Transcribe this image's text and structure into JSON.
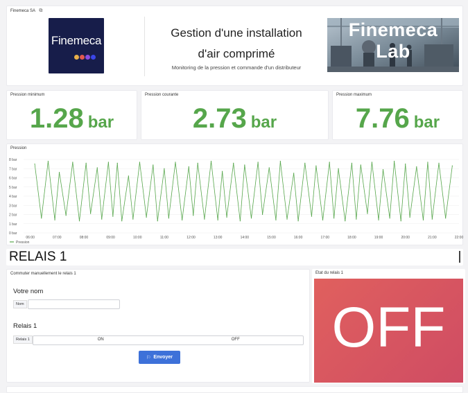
{
  "header_panel": {
    "title": "Finemeca SA",
    "link_icon": "external-link-icon",
    "logo": {
      "text": "Finemeca",
      "dot_colors": [
        "#e8b04a",
        "#e2594f",
        "#8a4ee0",
        "#3b46e8"
      ],
      "bg": "#171d4a"
    },
    "main_title_line1": "Gestion d'une installation",
    "main_title_line2": "d'air comprimé",
    "subtitle": "Monitoring de la pression et commande d'un distributeur",
    "photo_text_line1": "Finemeca",
    "photo_text_line2": "Lab"
  },
  "stats": [
    {
      "title": "Pression minimum",
      "value": "1.28",
      "unit": "bar"
    },
    {
      "title": "Pression courante",
      "value": "2.73",
      "unit": "bar"
    },
    {
      "title": "Pression maximum",
      "value": "7.76",
      "unit": "bar"
    }
  ],
  "colors": {
    "accent_green": "#56a64b",
    "button_blue": "#3d71d9",
    "off_red": "#d6545f"
  },
  "pressure_panel": {
    "title": "Pression",
    "legend": "Pression",
    "y_ticks": [
      "8 bar",
      "7 bar",
      "6 bar",
      "5 bar",
      "4 bar",
      "3 bar",
      "2 bar",
      "1 bar",
      "0 bar"
    ],
    "x_ticks": [
      "06:00",
      "07:00",
      "08:00",
      "09:00",
      "10:00",
      "11:00",
      "12:00",
      "13:00",
      "14:00",
      "15:00",
      "16:00",
      "17:00",
      "18:00",
      "19:00",
      "20:00",
      "21:00",
      "22:00"
    ]
  },
  "chart_data": {
    "type": "line",
    "series": [
      {
        "name": "Pression",
        "x": [
          "06:10",
          "06:25",
          "06:40",
          "06:55",
          "07:05",
          "07:20",
          "07:35",
          "07:50",
          "08:05",
          "08:15",
          "08:30",
          "08:40",
          "08:55",
          "09:05",
          "09:15",
          "09:25",
          "09:40",
          "09:50",
          "10:05",
          "10:20",
          "10:35",
          "10:45",
          "11:00",
          "11:10",
          "11:25",
          "11:40",
          "11:55",
          "12:05",
          "12:15",
          "12:30",
          "12:45",
          "13:00",
          "13:10",
          "13:20",
          "13:35",
          "13:50",
          "14:00",
          "14:15",
          "14:30",
          "14:40",
          "14:55",
          "15:10",
          "15:20",
          "15:35",
          "15:50",
          "16:00",
          "16:15",
          "16:30",
          "16:40",
          "16:55",
          "17:10",
          "17:20",
          "17:30",
          "17:45",
          "18:00",
          "18:10",
          "18:20",
          "18:35",
          "18:45",
          "19:00",
          "19:10",
          "19:25",
          "19:35",
          "19:50",
          "20:00",
          "20:10",
          "20:25",
          "20:40",
          "20:50",
          "21:00",
          "21:15",
          "21:30",
          "21:45"
        ],
        "values": [
          7.5,
          1.6,
          7.8,
          1.4,
          6.6,
          1.9,
          7.7,
          1.3,
          7.6,
          2.1,
          7.1,
          1.5,
          7.7,
          1.8,
          7.6,
          1.3,
          6.2,
          1.5,
          7.7,
          1.7,
          7.4,
          1.3,
          7.0,
          1.6,
          7.7,
          1.4,
          7.2,
          1.9,
          7.6,
          1.5,
          7.8,
          1.4,
          6.7,
          1.7,
          7.6,
          1.3,
          7.4,
          1.6,
          7.7,
          2.0,
          7.1,
          1.4,
          7.8,
          1.5,
          6.5,
          1.3,
          7.6,
          1.8,
          7.3,
          1.4,
          7.7,
          1.6,
          7.0,
          1.3,
          7.6,
          1.5,
          7.4,
          2.1,
          7.7,
          1.4,
          6.9,
          1.6,
          7.8,
          1.3,
          7.5,
          1.7,
          7.2,
          1.4,
          7.7,
          1.5,
          7.6,
          1.6,
          7.3
        ]
      }
    ],
    "ylabel": "",
    "ylim": [
      0,
      8
    ],
    "xlim": [
      "05:45",
      "22:00"
    ],
    "grid": true,
    "legend": "bottom-left"
  },
  "relais_section": {
    "title": "RELAIS 1"
  },
  "form_panel": {
    "title": "Commuter manuellement le relais 1",
    "name_heading": "Votre nom",
    "name_label": "Nom",
    "name_value": "",
    "relais_heading": "Relais 1",
    "relais_label": "Relais 1",
    "option_on": "ON",
    "option_off": "OFF",
    "submit_label": "Envoyer",
    "submit_icon": "send-icon"
  },
  "state_panel": {
    "title": "Etat du relais 1",
    "state": "OFF"
  }
}
